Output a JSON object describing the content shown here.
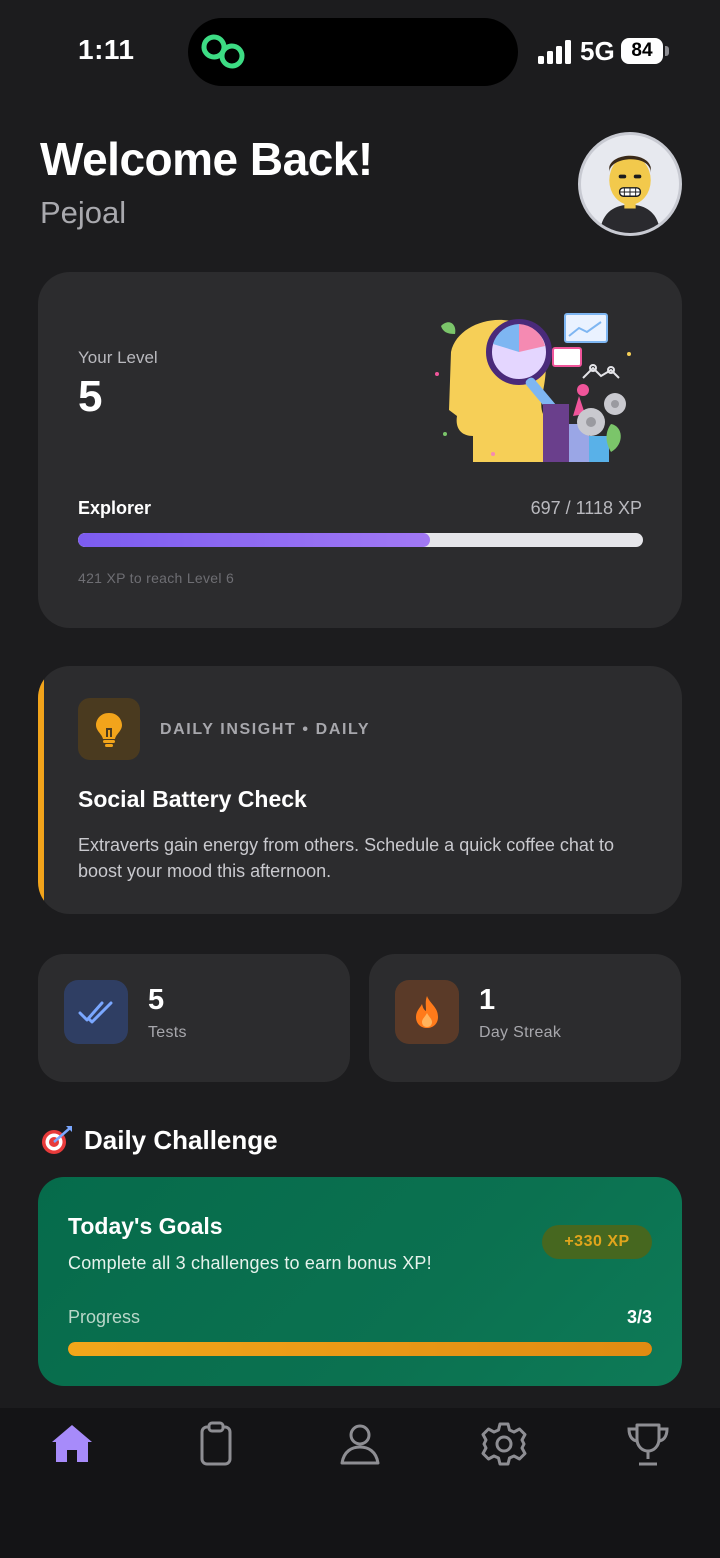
{
  "status_bar": {
    "time": "1:11",
    "network": "5G",
    "battery": "84",
    "icons": [
      "link-icon",
      "signal-icon"
    ]
  },
  "header": {
    "title": "Welcome Back!",
    "username": "Pejoal",
    "avatar_icon": "user-avatar"
  },
  "level_card": {
    "label": "Your Level",
    "level": "5",
    "rank": "Explorer",
    "xp_text": "697 / 1118 XP",
    "progress_fraction": 0.623,
    "next_level_text": "421 XP to reach Level 6",
    "illustration_icon": "head-analysis-illustration",
    "accent_color": "#7c5cf0"
  },
  "insight": {
    "icon": "lightbulb-icon",
    "tag": "DAILY INSIGHT • DAILY",
    "title": "Social Battery Check",
    "body": "Extraverts gain energy from others. Schedule a quick coffee chat to boost your mood this afternoon.",
    "accent_color": "#f2a41b"
  },
  "stats": {
    "tests": {
      "value": "5",
      "label": "Tests",
      "icon": "double-check-icon"
    },
    "streak": {
      "value": "1",
      "label": "Day Streak",
      "icon": "flame-icon"
    }
  },
  "daily_challenge": {
    "heading_icon": "target-dart-icon",
    "heading": "Daily Challenge",
    "goals_title": "Today's Goals",
    "goals_subtitle": "Complete all 3 challenges to earn bonus XP!",
    "xp_badge": "+330 XP",
    "progress_label": "Progress",
    "progress_count": "3/3",
    "progress_fraction": 1.0
  },
  "tabbar": {
    "tabs": [
      {
        "name": "home",
        "icon": "home-icon",
        "active": true
      },
      {
        "name": "tests",
        "icon": "clipboard-icon",
        "active": false
      },
      {
        "name": "profile",
        "icon": "user-icon",
        "active": false
      },
      {
        "name": "settings",
        "icon": "gear-icon",
        "active": false
      },
      {
        "name": "achievements",
        "icon": "trophy-icon",
        "active": false
      }
    ],
    "active_color": "#a78bfa",
    "inactive_color": "#8e8e93"
  }
}
